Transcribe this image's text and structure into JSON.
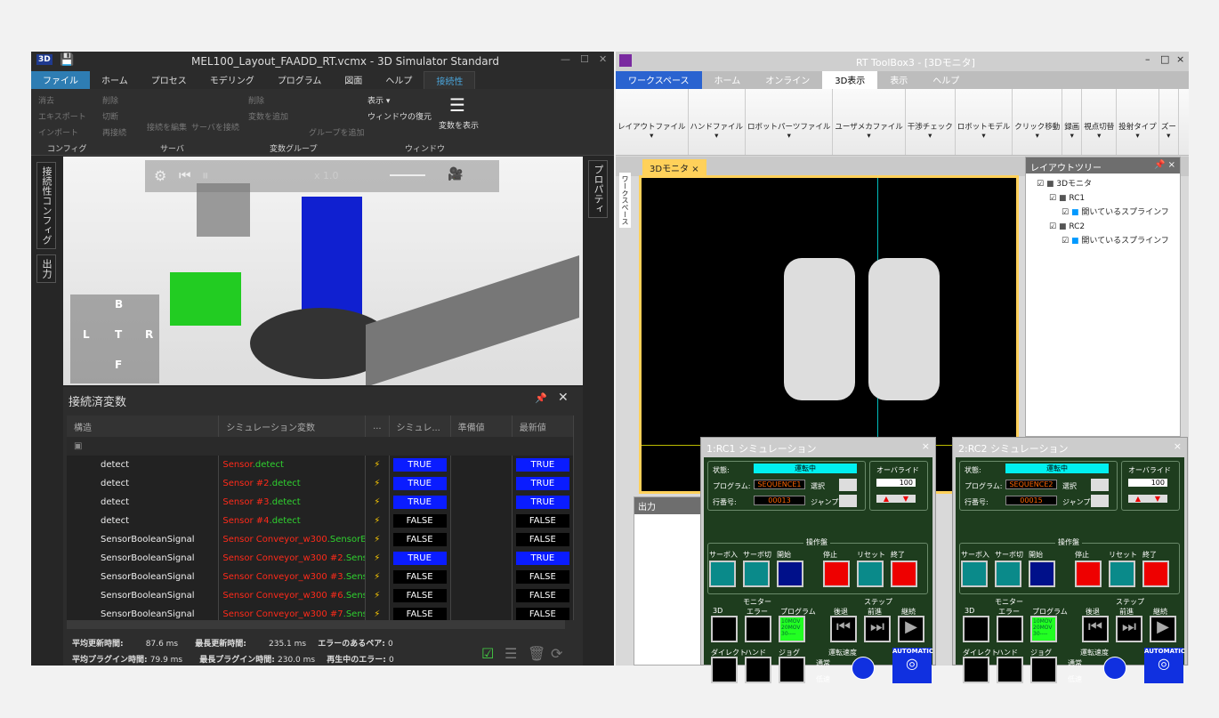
{
  "left": {
    "title": "MEL100_Layout_FAADD_RT.vcmx - 3D Simulator Standard",
    "app_icon": "3D",
    "tabs": [
      "ファイル",
      "ホーム",
      "プロセス",
      "モデリング",
      "プログラム",
      "図面",
      "ヘルプ",
      "接続性"
    ],
    "ribbon": {
      "clear": "消去",
      "export": "エキスポート",
      "import": "インポート",
      "group_config": "コンフィグ",
      "delete": "削除",
      "disconnect": "切断",
      "reconnect": "再接続",
      "edit_connection": "接続を編集",
      "connect_server": "サーバを接続",
      "group_server": "サーバ",
      "delete2": "削除",
      "add_variable": "変数を追加",
      "add_group": "グループを追加",
      "group_vars": "変数グループ",
      "show": "表示 ▾",
      "restore_window": "ウィンドウの復元",
      "show_variables": "変数を表示",
      "group_window": "ウィンドウ"
    },
    "side_tabs": [
      "接続性コンフィグ",
      "出力"
    ],
    "right_tab": "プロパティ",
    "viewport": {
      "speed": "x 1.0",
      "view_labels": [
        "B",
        "L",
        "T",
        "R",
        "F"
      ]
    },
    "panel": {
      "title": "接続済変数",
      "columns": [
        "構造",
        "シミュレーション変数",
        "...",
        "シミュレ...",
        "準備値",
        "最新値"
      ],
      "rows": [
        {
          "struct": "detect",
          "prefix": "Sensor",
          "suffix": ".detect",
          "sim": "TRUE",
          "latest": "TRUE"
        },
        {
          "struct": "detect",
          "prefix": "Sensor #2",
          "suffix": ".detect",
          "sim": "TRUE",
          "latest": "TRUE"
        },
        {
          "struct": "detect",
          "prefix": "Sensor #3",
          "suffix": ".detect",
          "sim": "TRUE",
          "latest": "TRUE"
        },
        {
          "struct": "detect",
          "prefix": "Sensor #4",
          "suffix": ".detect",
          "sim": "FALSE",
          "latest": "FALSE"
        },
        {
          "struct": "SensorBooleanSignal",
          "prefix": "Sensor Conveyor_w300",
          "suffix": ".SensorBoo",
          "sim": "FALSE",
          "latest": "FALSE"
        },
        {
          "struct": "SensorBooleanSignal",
          "prefix": "Sensor Conveyor_w300 #2",
          "suffix": ".Sensor",
          "sim": "TRUE",
          "latest": "TRUE"
        },
        {
          "struct": "SensorBooleanSignal",
          "prefix": "Sensor Conveyor_w300 #3",
          "suffix": ".Sensor",
          "sim": "FALSE",
          "latest": "FALSE"
        },
        {
          "struct": "SensorBooleanSignal",
          "prefix": "Sensor Conveyor_w300 #6",
          "suffix": ".Sensor",
          "sim": "FALSE",
          "latest": "FALSE"
        },
        {
          "struct": "SensorBooleanSignal",
          "prefix": "Sensor Conveyor_w300 #7",
          "suffix": ".Sensor",
          "sim": "FALSE",
          "latest": "FALSE"
        }
      ],
      "stats": {
        "avg_update_label": "平均更新時間:",
        "avg_update": "87.6 ms",
        "max_update_label": "最長更新時間:",
        "max_update": "235.1 ms",
        "err_pairs_label": "エラーのあるペア:",
        "err_pairs": "0",
        "avg_plugin_label": "平均プラグイン時間:",
        "avg_plugin": "79.9 ms",
        "max_plugin_label": "最長プラグイン時間:",
        "max_plugin": "230.0 ms",
        "play_err_label": "再生中のエラー:",
        "play_err": "0"
      }
    }
  },
  "right": {
    "title": "RT ToolBox3 - [3Dモニタ]",
    "tabs": [
      "ワークスペース",
      "ホーム",
      "オンライン",
      "3D表示",
      "表示",
      "ヘルプ"
    ],
    "ribbon": [
      "レイアウトファイル",
      "ハンドファイル",
      "ロボットパーツファイル",
      "ユーザメカファイル",
      "干渉チェック",
      "ロボットモデル",
      "クリック移動",
      "録画",
      "視点切替",
      "投射タイプ",
      "ズー"
    ],
    "workspace_tab": "ワークスペース",
    "doc_tab": "3Dモニタ",
    "tree": {
      "title": "レイアウトツリー",
      "items": [
        {
          "label": "3Dモニタ",
          "level": 0
        },
        {
          "label": "RC1",
          "level": 1
        },
        {
          "label": "開いているスプラインフ",
          "level": 2
        },
        {
          "label": "RC2",
          "level": 1
        },
        {
          "label": "開いているスプラインフ",
          "level": 2
        }
      ]
    },
    "output_title": "出力",
    "sims": [
      {
        "title": "1:RC1 シミュレーション",
        "state": "運転中",
        "program": "SEQUENCE1",
        "line": "00013",
        "override": "100"
      },
      {
        "title": "2:RC2 シミュレーション",
        "state": "運転中",
        "program": "SEQUENCE2",
        "line": "00015",
        "override": "100"
      }
    ],
    "sim_labels": {
      "state": "状態:",
      "program": "プログラム:",
      "line": "行番号:",
      "select": "選択",
      "jump": "ジャンプ",
      "override": "オーバライド",
      "panel": "操作盤",
      "buttons": [
        "サーボ入",
        "サーボ切",
        "開始",
        "停止",
        "リセット",
        "終了"
      ],
      "monitor": "モニター",
      "mon": [
        "3D",
        "エラー",
        "プログラム"
      ],
      "step": "ステップ",
      "steps": [
        "後退",
        "前進",
        "継続"
      ],
      "bottom": [
        "ダイレクト",
        "ハンド",
        "ジョグ"
      ],
      "speed": "運転速度",
      "normal": "通常",
      "low": "低速",
      "auto": "AUTOMATIC",
      "prog_preview": "10MOV 20MOV 30----"
    }
  },
  "colors": {
    "true": "#0a1cff",
    "false": "#000000",
    "sim_bg": "#1e3d1e",
    "state_bg": "#00f0f0"
  }
}
